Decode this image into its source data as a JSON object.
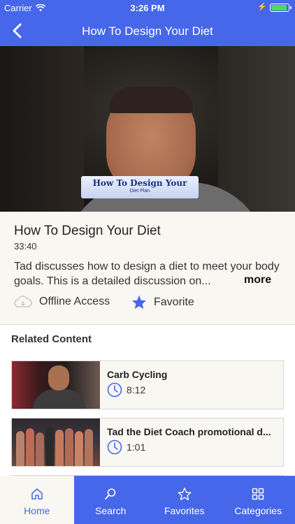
{
  "status_bar": {
    "carrier": "Carrier",
    "time": "3:26 PM",
    "battery_level": 0.9
  },
  "nav": {
    "title": "How To Design Your Diet",
    "back_icon": "chevron-left-icon"
  },
  "video": {
    "caption_line1": "How To Design Your",
    "caption_line2": "Diet Plan"
  },
  "details": {
    "title": "How To Design Your Diet",
    "duration": "33:40",
    "description": "Tad discusses how to design a diet to meet your body goals. This is a detailed discussion on...",
    "more_label": "more",
    "offline_label": "Offline Access",
    "favorite_label": "Favorite"
  },
  "related": {
    "heading": "Related Content",
    "items": [
      {
        "title": "Carb Cycling",
        "duration": "8:12"
      },
      {
        "title": "Tad the Diet Coach promotional d...",
        "duration": "1:01"
      },
      {
        "title": "",
        "duration": ""
      }
    ]
  },
  "tabs": [
    {
      "label": "Home",
      "icon": "home-icon",
      "active": true
    },
    {
      "label": "Search",
      "icon": "search-icon",
      "active": false
    },
    {
      "label": "Favorites",
      "icon": "star-icon",
      "active": false
    },
    {
      "label": "Categories",
      "icon": "grid-icon",
      "active": false
    }
  ],
  "colors": {
    "brand": "#4667ea",
    "panel": "#f8f7f2"
  }
}
